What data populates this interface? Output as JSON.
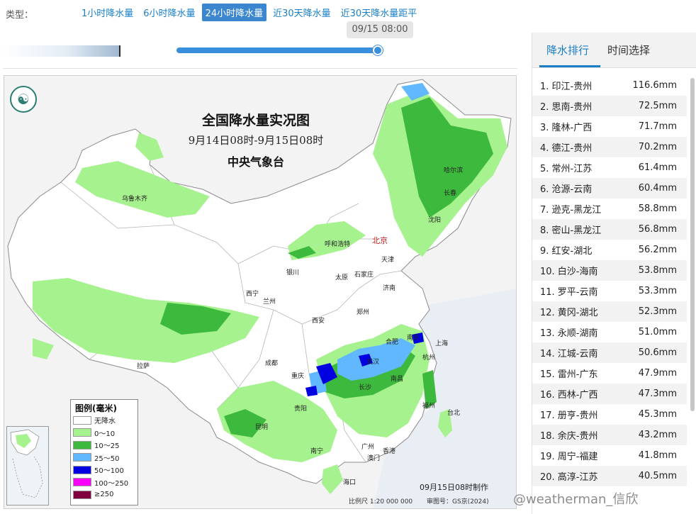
{
  "typebar": {
    "label": "类型：",
    "tabs": [
      {
        "label": "1小时降水量",
        "active": false
      },
      {
        "label": "6小时降水量",
        "active": false
      },
      {
        "label": "24小时降水量",
        "active": true
      },
      {
        "label": "近30天降水量",
        "active": false
      },
      {
        "label": "近30天降水量距平",
        "active": false
      }
    ]
  },
  "timeline": {
    "tooltip": "09/15 08:00",
    "progress": 0.98
  },
  "map": {
    "title": "全国降水量实况图",
    "subtitle": "9月14日08时-9月15日08时",
    "org": "中央气象台",
    "made_time": "09月15日08时制作",
    "scale": "比例尺 1:20 000 000",
    "map_no": "审图号：GS京(2024)",
    "cities": [
      {
        "name": "哈尔滨",
        "capital": false
      },
      {
        "name": "长春",
        "capital": false
      },
      {
        "name": "乌鲁木齐",
        "capital": false
      },
      {
        "name": "沈阳",
        "capital": false
      },
      {
        "name": "呼和浩特",
        "capital": false
      },
      {
        "name": "北京",
        "capital": true
      },
      {
        "name": "天津",
        "capital": false
      },
      {
        "name": "银川",
        "capital": false
      },
      {
        "name": "太原",
        "capital": false
      },
      {
        "name": "石家庄",
        "capital": false
      },
      {
        "name": "西宁",
        "capital": false
      },
      {
        "name": "兰州",
        "capital": false
      },
      {
        "name": "济南",
        "capital": false
      },
      {
        "name": "郑州",
        "capital": false
      },
      {
        "name": "西安",
        "capital": false
      },
      {
        "name": "合肥",
        "capital": false
      },
      {
        "name": "南京",
        "capital": false
      },
      {
        "name": "上海",
        "capital": false
      },
      {
        "name": "武汉",
        "capital": false
      },
      {
        "name": "杭州",
        "capital": false
      },
      {
        "name": "拉萨",
        "capital": false
      },
      {
        "name": "成都",
        "capital": false
      },
      {
        "name": "重庆",
        "capital": false
      },
      {
        "name": "南昌",
        "capital": false
      },
      {
        "name": "长沙",
        "capital": false
      },
      {
        "name": "贵阳",
        "capital": false
      },
      {
        "name": "福州",
        "capital": false
      },
      {
        "name": "台北",
        "capital": false
      },
      {
        "name": "昆明",
        "capital": false
      },
      {
        "name": "南宁",
        "capital": false
      },
      {
        "name": "广州",
        "capital": false
      },
      {
        "name": "香港",
        "capital": false
      },
      {
        "name": "澳门",
        "capital": false
      },
      {
        "name": "海口",
        "capital": false
      }
    ],
    "legend": {
      "title": "图例(毫米)",
      "items": [
        {
          "label": "无降水",
          "color": "#ffffff"
        },
        {
          "label": "0～10",
          "color": "#a6f28f"
        },
        {
          "label": "10～25",
          "color": "#3dba3d"
        },
        {
          "label": "25～50",
          "color": "#61b8ff"
        },
        {
          "label": "50～100",
          "color": "#0000e1"
        },
        {
          "label": "100～250",
          "color": "#fa00fa"
        },
        {
          "label": "≥250",
          "color": "#800040"
        }
      ]
    }
  },
  "rank_panel": {
    "tabs": [
      {
        "label": "降水排行",
        "active": true
      },
      {
        "label": "时间选择",
        "active": false
      }
    ],
    "items": [
      {
        "station": "1. 印江-贵州",
        "value": "116.6mm"
      },
      {
        "station": "2. 思南-贵州",
        "value": "72.5mm"
      },
      {
        "station": "3. 隆林-广西",
        "value": "71.7mm"
      },
      {
        "station": "4. 德江-贵州",
        "value": "70.2mm"
      },
      {
        "station": "5. 常州-江苏",
        "value": "61.4mm"
      },
      {
        "station": "6. 沧源-云南",
        "value": "60.4mm"
      },
      {
        "station": "7. 逊克-黑龙江",
        "value": "58.8mm"
      },
      {
        "station": "8. 密山-黑龙江",
        "value": "56.8mm"
      },
      {
        "station": "9. 红安-湖北",
        "value": "56.2mm"
      },
      {
        "station": "10. 白沙-海南",
        "value": "53.8mm"
      },
      {
        "station": "11. 罗平-云南",
        "value": "53.3mm"
      },
      {
        "station": "12. 黄冈-湖北",
        "value": "52.3mm"
      },
      {
        "station": "13. 永顺-湖南",
        "value": "51.0mm"
      },
      {
        "station": "14. 江城-云南",
        "value": "50.6mm"
      },
      {
        "station": "15. 雷州-广东",
        "value": "47.9mm"
      },
      {
        "station": "16. 西林-广西",
        "value": "47.3mm"
      },
      {
        "station": "17. 册亨-贵州",
        "value": "45.3mm"
      },
      {
        "station": "18. 余庆-贵州",
        "value": "43.2mm"
      },
      {
        "station": "19. 周宁-福建",
        "value": "41.8mm"
      },
      {
        "station": "20. 高淳-江苏",
        "value": "40.5mm"
      }
    ]
  },
  "watermark": "@weatherman_信欣"
}
